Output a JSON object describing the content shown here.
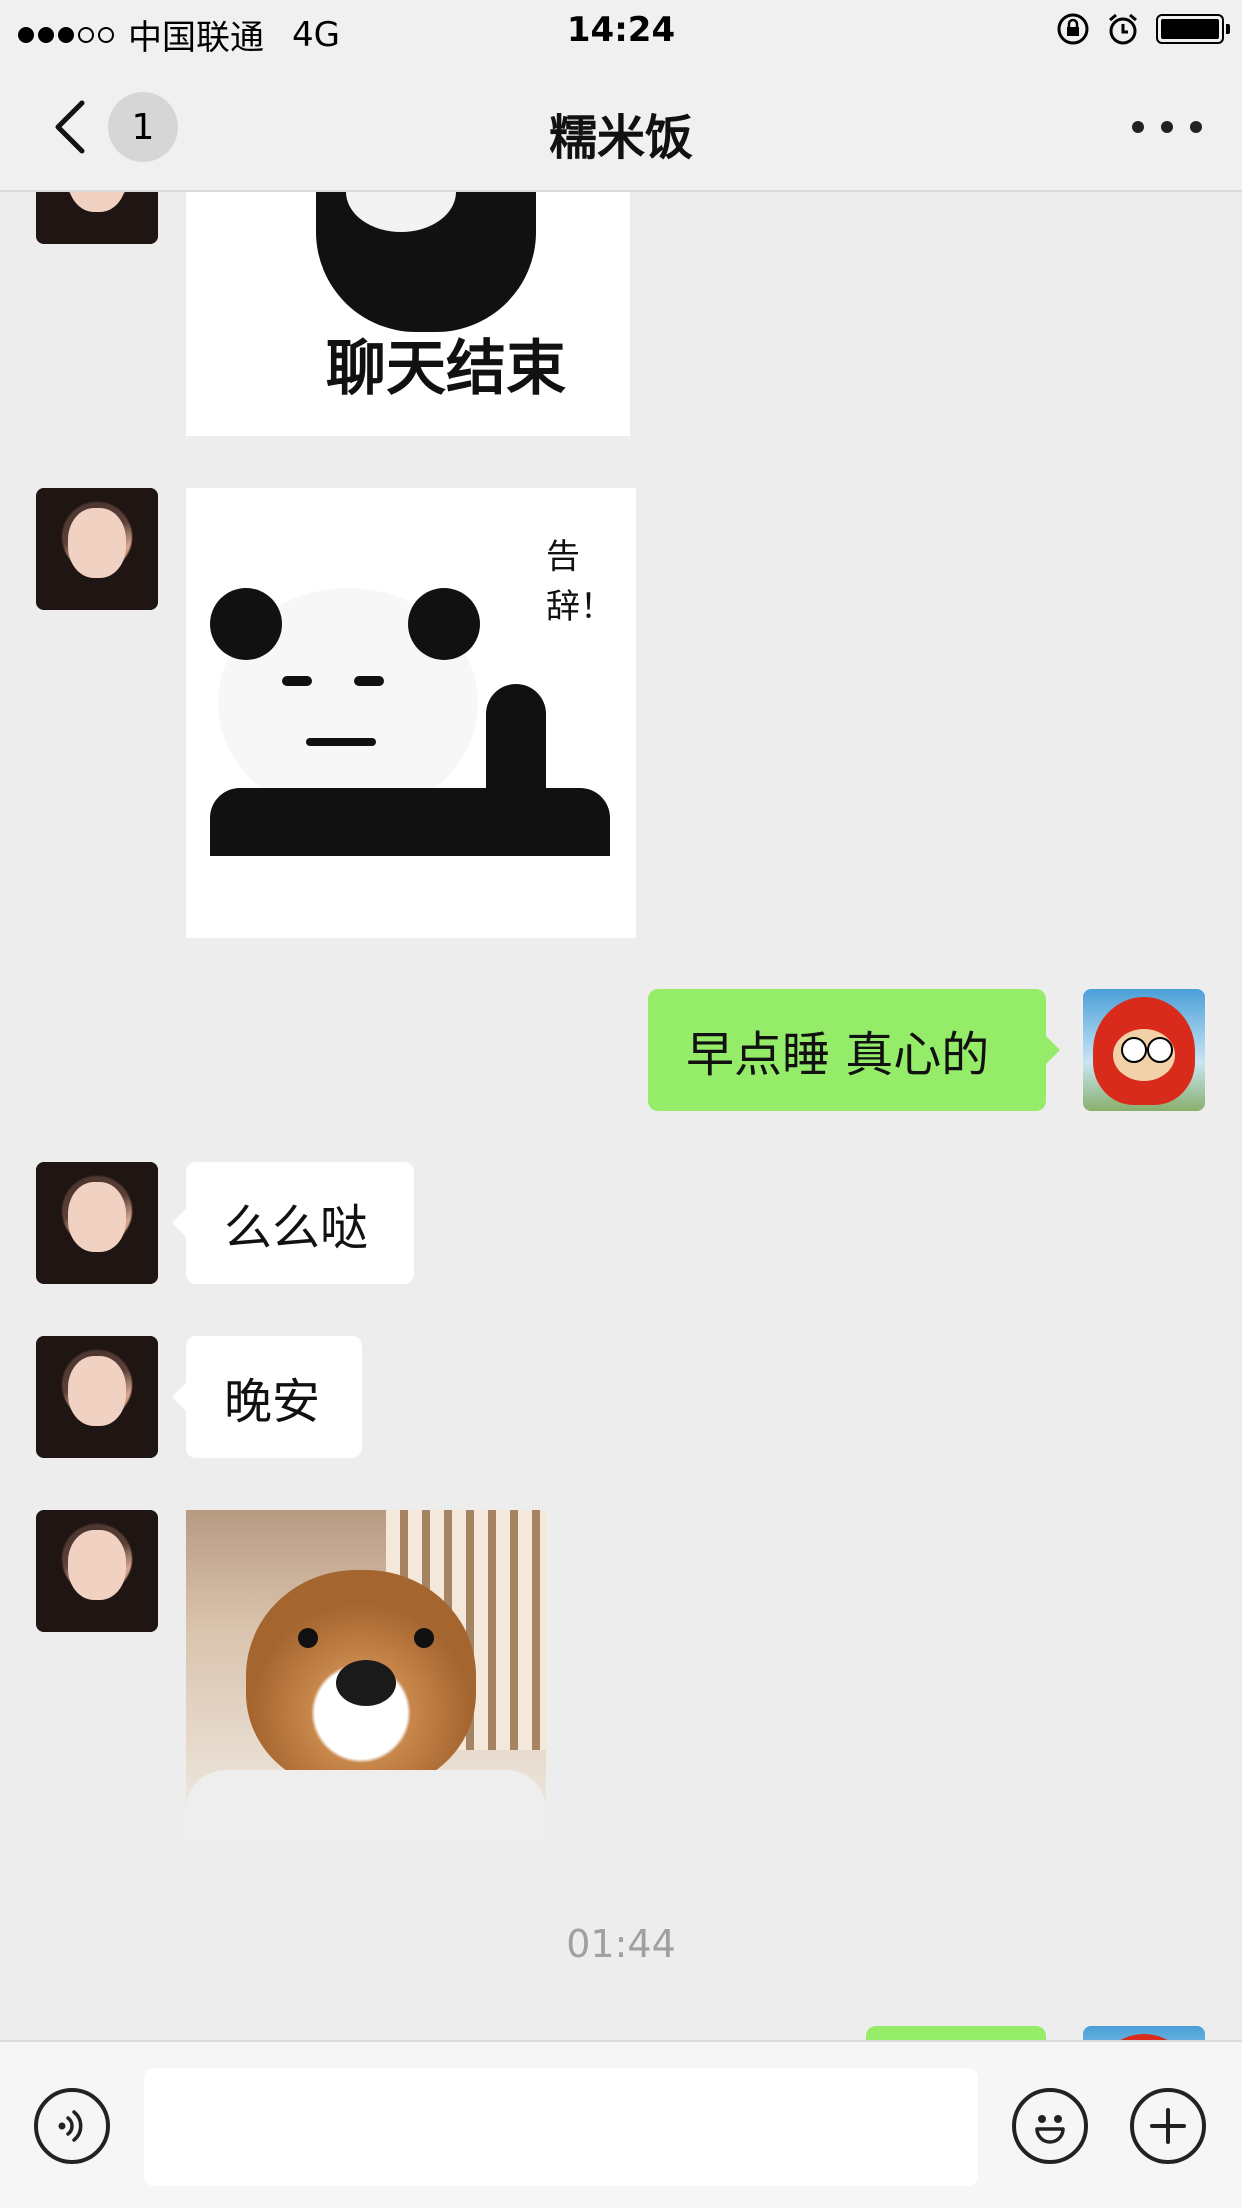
{
  "status_bar": {
    "carrier": "中国联通",
    "network": "4G",
    "time": "14:24"
  },
  "nav": {
    "back_badge": "1",
    "title": "糯米饭"
  },
  "messages": {
    "sticker1_text": "聊天结束",
    "sticker2_text": "告辞！",
    "out1": "早点睡 真心的",
    "in1": "么么哒",
    "in2": "晚安",
    "timestamp": "01:44"
  },
  "input": {
    "placeholder": ""
  },
  "colors": {
    "outgoing_bubble": "#95ec69",
    "incoming_bubble": "#ffffff",
    "background": "#ededed"
  }
}
